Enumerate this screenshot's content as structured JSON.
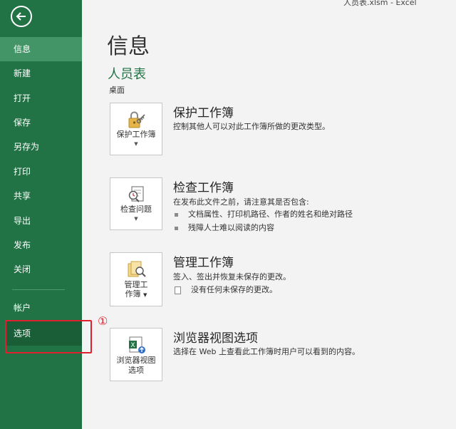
{
  "window": {
    "title": "人员表.xlsm  -  Excel"
  },
  "sidebar": {
    "items": [
      {
        "label": "信息"
      },
      {
        "label": "新建"
      },
      {
        "label": "打开"
      },
      {
        "label": "保存"
      },
      {
        "label": "另存为"
      },
      {
        "label": "打印"
      },
      {
        "label": "共享"
      },
      {
        "label": "导出"
      },
      {
        "label": "发布"
      },
      {
        "label": "关闭"
      },
      {
        "label": "帐户"
      },
      {
        "label": "选项"
      }
    ]
  },
  "annotation": {
    "marker": "①",
    "color": "#e0202e"
  },
  "main": {
    "title": "信息",
    "file_name": "人员表",
    "file_path": "桌面",
    "sections": [
      {
        "button_line1": "保护工作簿",
        "button_line2": "",
        "title": "保护工作簿",
        "desc": "控制其他人可以对此工作簿所做的更改类型。"
      },
      {
        "button_line1": "检查问题",
        "button_line2": "",
        "title": "检查工作簿",
        "desc": "在发布此文件之前，请注意其是否包含:",
        "bullets": [
          "文档属性、打印机路径、作者的姓名和绝对路径",
          "残障人士难以阅读的内容"
        ]
      },
      {
        "button_line1": "管理工",
        "button_line2": "作簿",
        "title": "管理工作簿",
        "desc": "签入、签出并恢复未保存的更改。",
        "note": "没有任何未保存的更改。"
      },
      {
        "button_line1": "浏览器视图",
        "button_line2": "选项",
        "title": "浏览器视图选项",
        "desc": "选择在 Web 上查看此工作簿时用户可以看到的内容。"
      }
    ]
  },
  "colors": {
    "sidebar": "#217346",
    "active_item": "#439467",
    "accent_text": "#217346"
  }
}
